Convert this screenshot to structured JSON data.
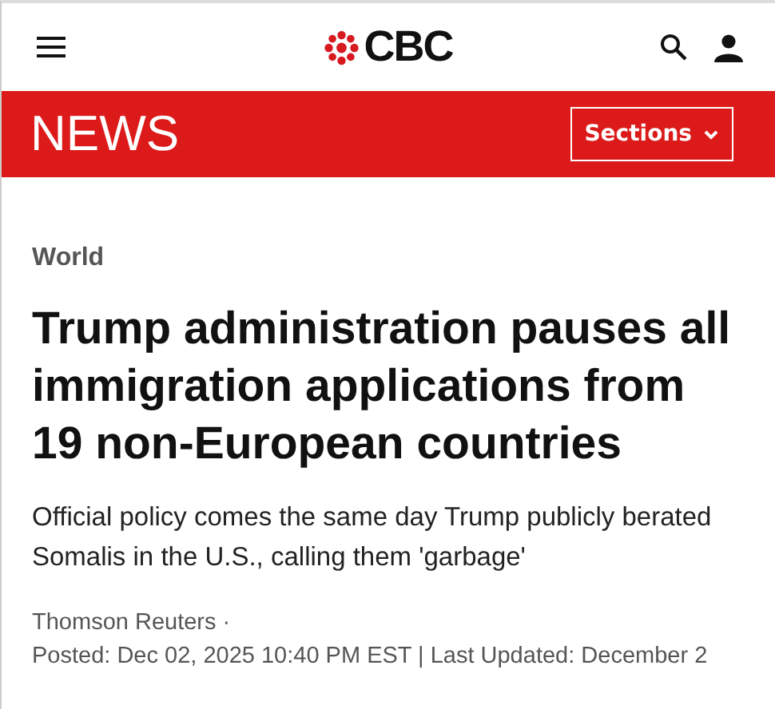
{
  "header": {
    "logo_text": "CBC"
  },
  "news_bar": {
    "title": "NEWS",
    "sections_button": "Sections"
  },
  "article": {
    "category": "World",
    "headline": "Trump administration pauses all immigration applications from 19 non-European countries",
    "subheadline": "Official policy comes the same day Trump publicly berated Somalis in the U.S., calling them 'garbage'",
    "byline": "Thomson Reuters ·",
    "dateline": "Posted: Dec 02, 2025 10:40 PM EST | Last Updated: December 2"
  }
}
